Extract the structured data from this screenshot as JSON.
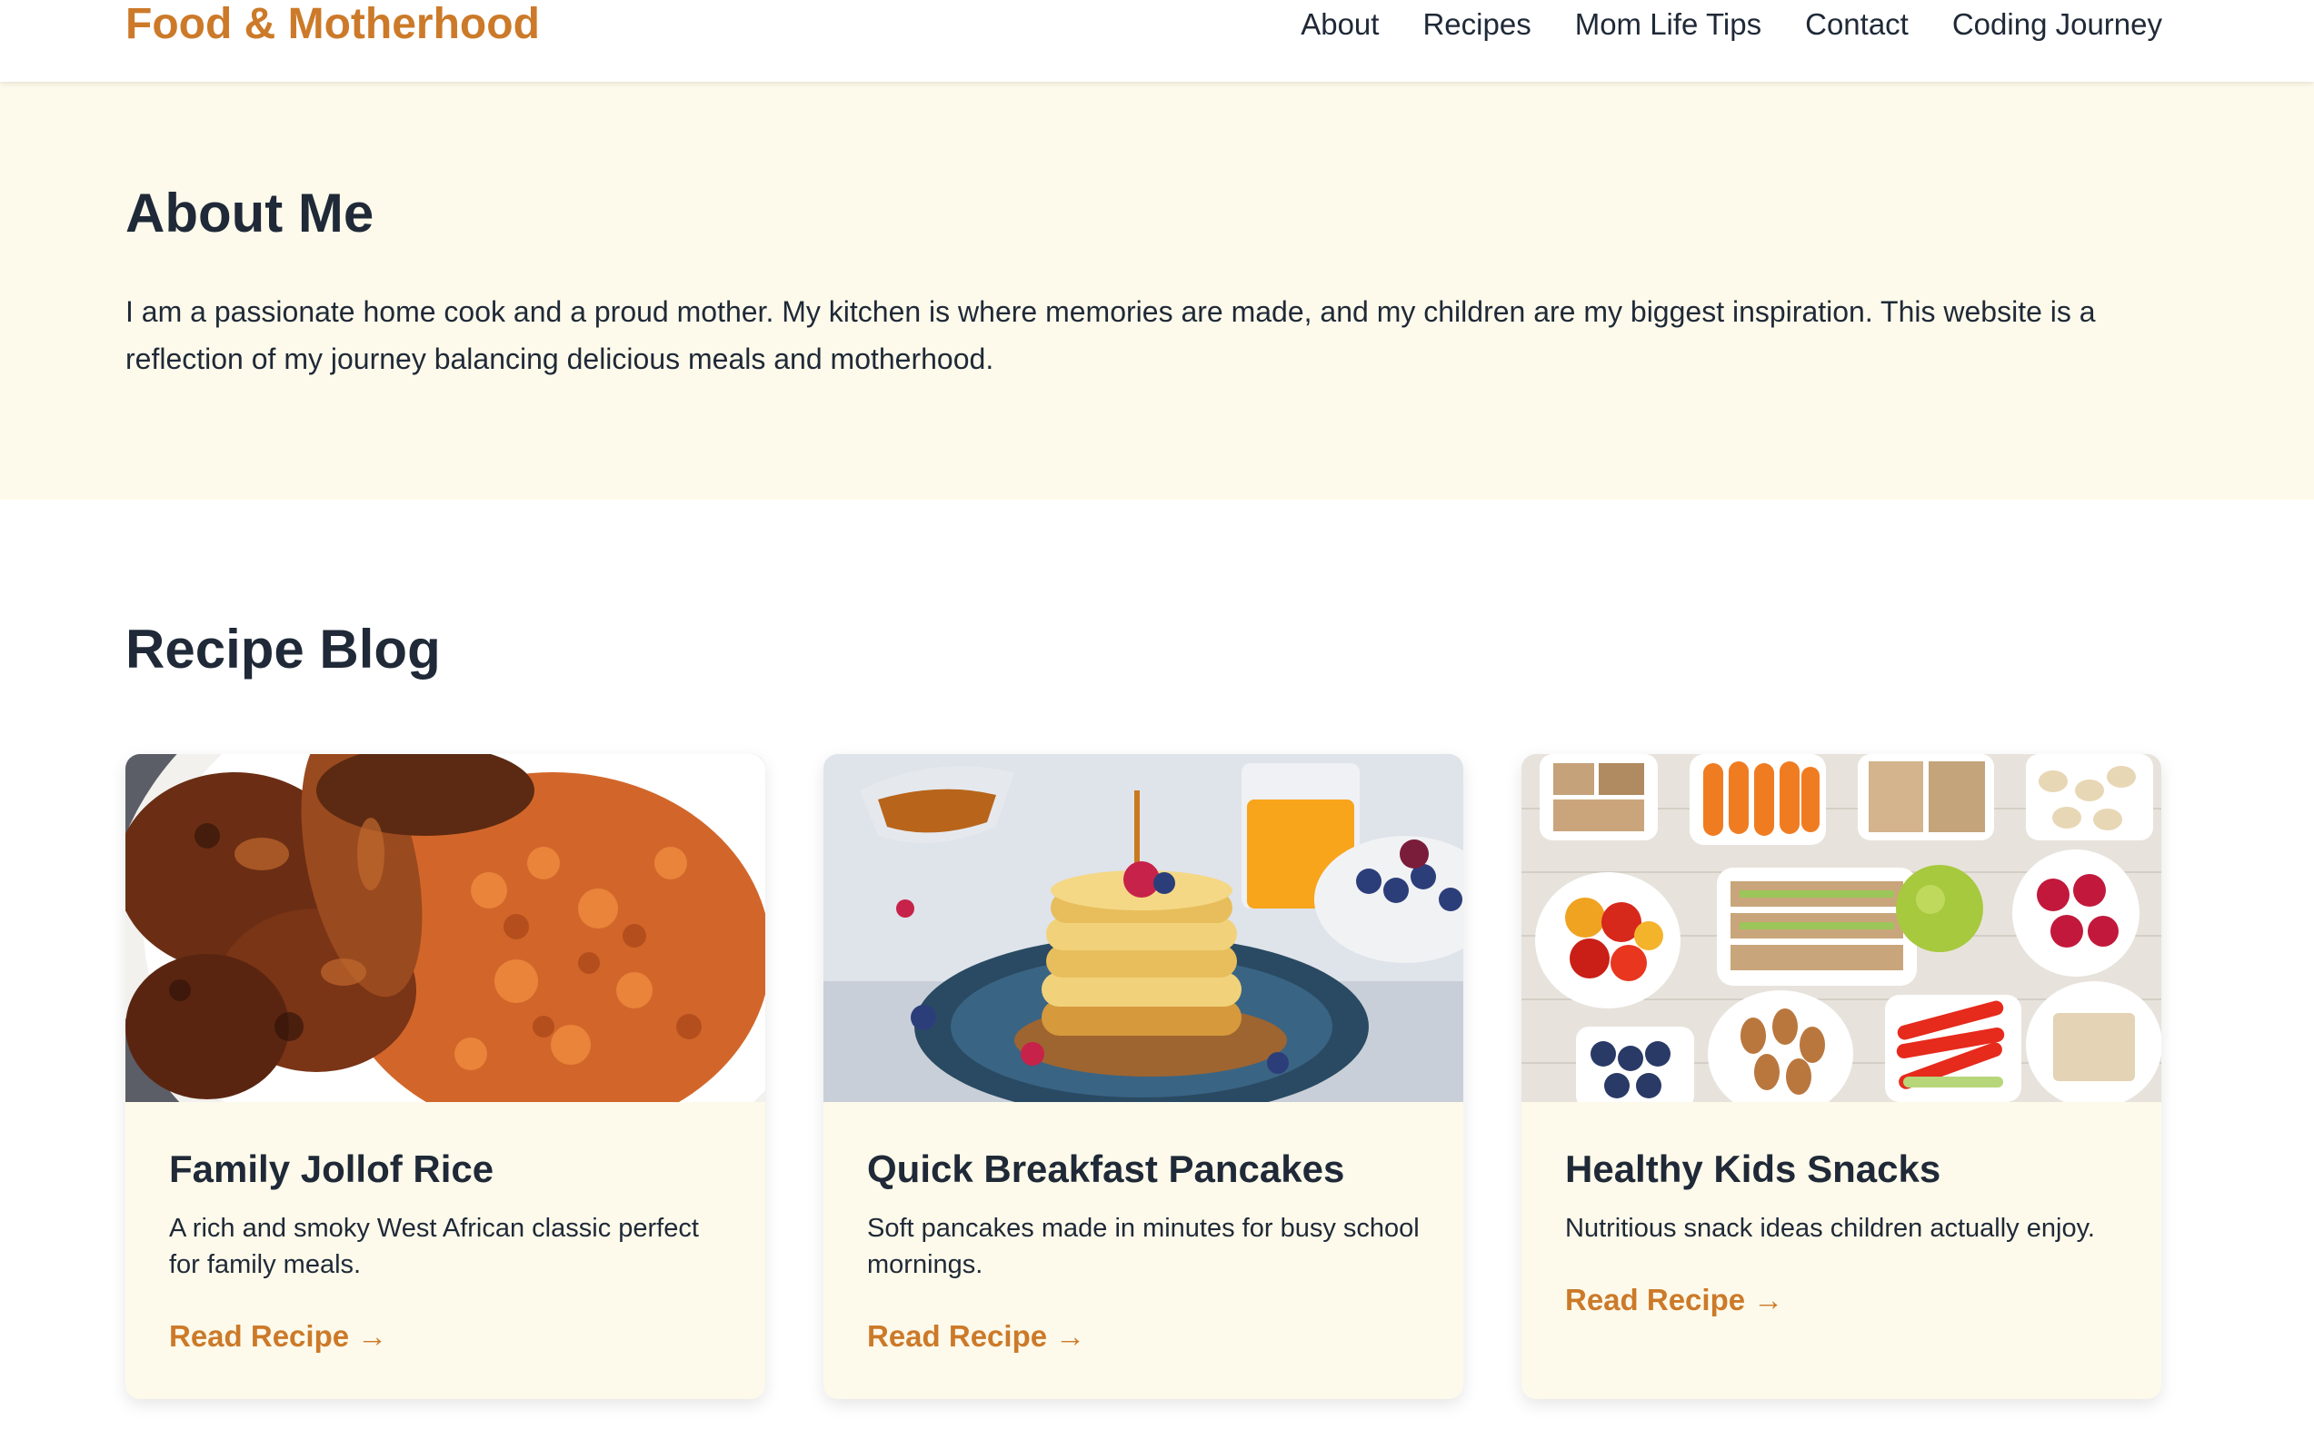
{
  "brand": {
    "name": "Food & Motherhood",
    "color": "#cc7a29"
  },
  "nav": {
    "items": [
      {
        "label": "About"
      },
      {
        "label": "Recipes"
      },
      {
        "label": "Mom Life Tips"
      },
      {
        "label": "Contact"
      },
      {
        "label": "Coding Journey"
      }
    ]
  },
  "about": {
    "title": "About Me",
    "text": "I am a passionate home cook and a proud mother. My kitchen is where memories are made, and my children are my biggest inspiration. This website is a reflection of my journey balancing delicious meals and motherhood.",
    "background": "#fdfaeb"
  },
  "blog": {
    "title": "Recipe Blog",
    "cards": [
      {
        "image": "jollof-rice-photo",
        "title": "Family Jollof Rice",
        "description": "A rich and smoky West African classic perfect for family meals.",
        "link": "Read Recipe →"
      },
      {
        "image": "pancakes-photo",
        "title": "Quick Breakfast Pancakes",
        "description": "Soft pancakes made in minutes for busy school mornings.",
        "link": "Read Recipe →"
      },
      {
        "image": "kids-snacks-photo",
        "title": "Healthy Kids Snacks",
        "description": "Nutritious snack ideas children actually enjoy.",
        "link": "Read Recipe →"
      }
    ]
  }
}
